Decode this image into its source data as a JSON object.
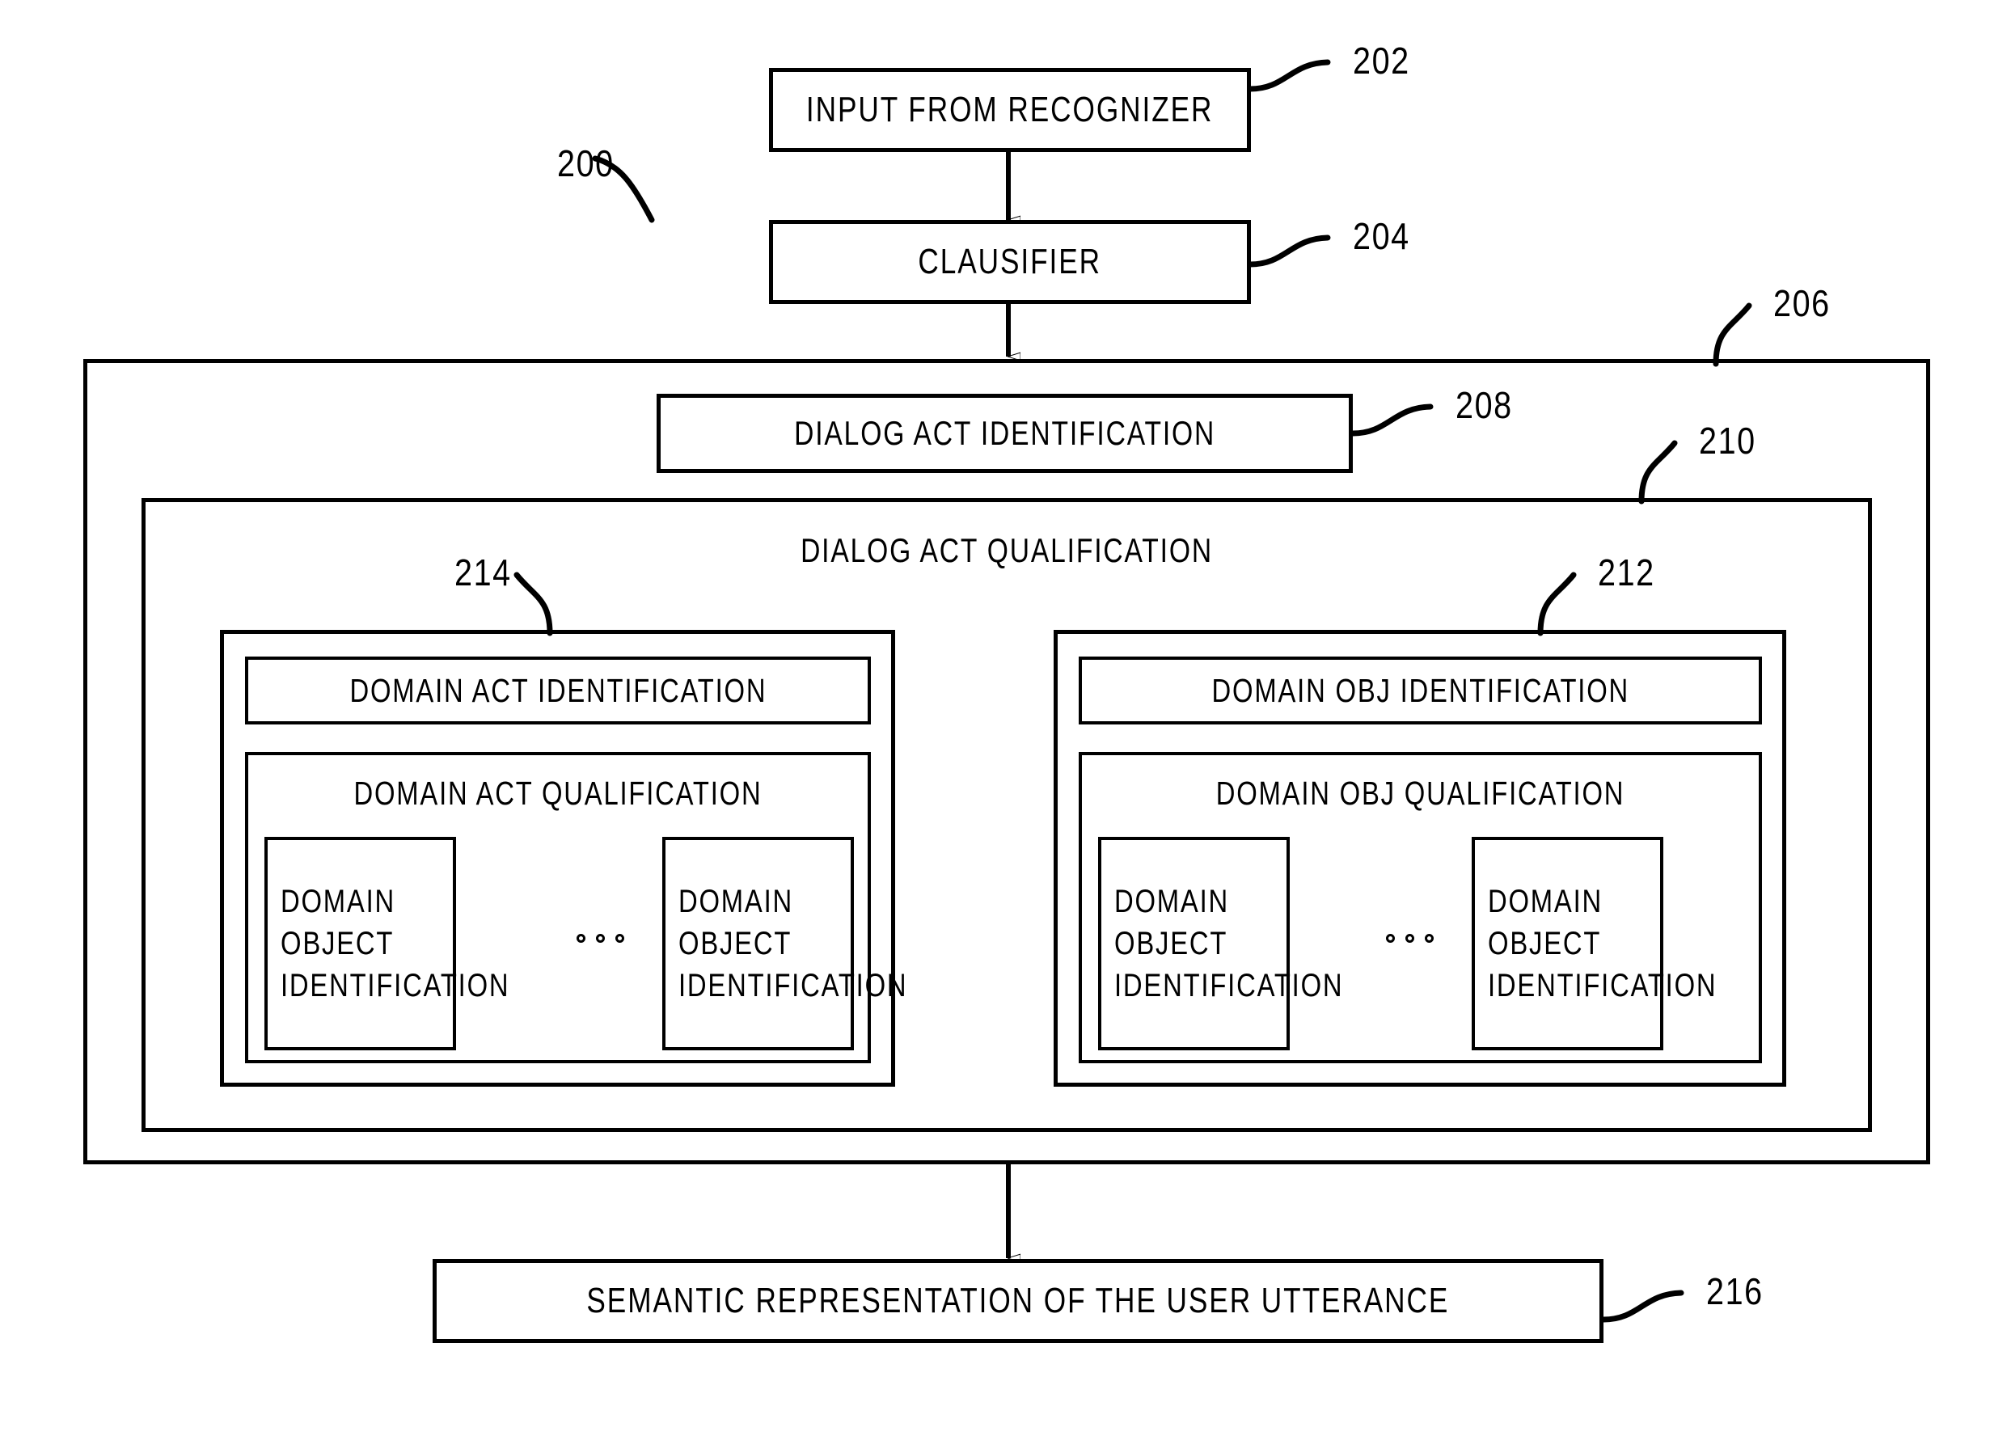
{
  "figure": {
    "id": "200",
    "type": "block-diagram"
  },
  "nodes": {
    "input_from_recognizer": {
      "label": "INPUT FROM RECOGNIZER",
      "ref": "202"
    },
    "clausifier": {
      "label": "CLAUSIFIER",
      "ref": "204"
    },
    "outer_processor": {
      "ref": "206"
    },
    "dialog_act_identification": {
      "label": "DIALOG ACT IDENTIFICATION",
      "ref": "208"
    },
    "dialog_act_qualification": {
      "label": "DIALOG ACT QUALIFICATION",
      "ref": "210"
    },
    "domain_act_group": {
      "ref": "214"
    },
    "domain_obj_group": {
      "ref": "212"
    },
    "domain_act_identification": {
      "label": "DOMAIN ACT IDENTIFICATION"
    },
    "domain_act_qualification": {
      "label": "DOMAIN ACT QUALIFICATION"
    },
    "domain_obj_identification": {
      "label": "DOMAIN OBJ IDENTIFICATION"
    },
    "domain_obj_qualification": {
      "label": "DOMAIN OBJ QUALIFICATION"
    },
    "semantic_representation": {
      "label": "SEMANTIC REPRESENTATION OF THE USER UTTERANCE",
      "ref": "216"
    }
  },
  "leaf_stacks": [
    {
      "id": "act-left",
      "line1": "DOMAIN",
      "line2": "OBJECT",
      "line3": "IDENTIFICATION"
    },
    {
      "id": "act-right",
      "line1": "DOMAIN",
      "line2": "OBJECT",
      "line3": "IDENTIFICATION"
    },
    {
      "id": "obj-left",
      "line1": "DOMAIN",
      "line2": "OBJECT",
      "line3": "IDENTIFICATION"
    },
    {
      "id": "obj-right",
      "line1": "DOMAIN",
      "line2": "OBJECT",
      "line3": "IDENTIFICATION"
    }
  ],
  "ellipsis_symbol": "○ ○ ○",
  "colors": {
    "ink": "#000000",
    "paper": "#ffffff"
  }
}
